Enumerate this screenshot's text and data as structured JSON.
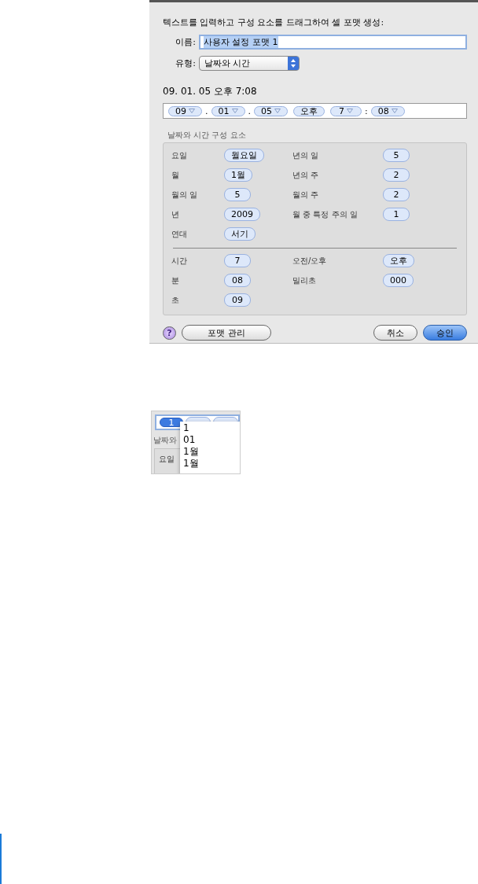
{
  "dialog": {
    "instruction": "텍스트를 입력하고 구성 요소를 드래그하여 셀 포맷 생성:",
    "name_field": {
      "label": "이름:",
      "value": "사용자 설정 포맷 1",
      "selected": true
    },
    "type_popup": {
      "label": "유형:",
      "value": "날짜와 시간"
    },
    "preview": "09. 01. 05 오후 7:08",
    "format_tokens": [
      {
        "kind": "menu",
        "text": "09",
        "after": "."
      },
      {
        "kind": "menu",
        "text": "01",
        "after": "."
      },
      {
        "kind": "menu",
        "text": "05"
      },
      {
        "kind": "plain",
        "text": "오후"
      },
      {
        "kind": "menu",
        "text": "7",
        "after": ":"
      },
      {
        "kind": "menu",
        "text": "08"
      }
    ],
    "components": {
      "title": "날짜와 시간 구성 요소",
      "sections": [
        [
          {
            "label": "요일",
            "value": "월요일"
          },
          {
            "label": "년의 일",
            "value": "5"
          },
          {
            "label": "월",
            "value": "1월"
          },
          {
            "label": "년의 주",
            "value": "2"
          },
          {
            "label": "월의 일",
            "value": "5"
          },
          {
            "label": "월의 주",
            "value": "2"
          },
          {
            "label": "년",
            "value": "2009"
          },
          {
            "label": "월 중 특정 주의 일",
            "value": "1"
          },
          {
            "label": "연대",
            "value": "서기"
          }
        ],
        [
          {
            "label": "시간",
            "value": "7"
          },
          {
            "label": "오전/오후",
            "value": "오후"
          },
          {
            "label": "분",
            "value": "08"
          },
          {
            "label": "밀리초",
            "value": "000"
          },
          {
            "label": "초",
            "value": "09"
          }
        ]
      ]
    },
    "buttons": [
      {
        "kind": "help",
        "text": "?"
      },
      {
        "kind": "normal",
        "text": "포맷 관리"
      },
      {
        "kind": "normal",
        "text": "취소"
      },
      {
        "kind": "default",
        "text": "승인"
      }
    ]
  },
  "inset": {
    "token": {
      "text": "1",
      "selected": true
    },
    "group_label": "날짜와",
    "row_label": "요일",
    "menu_items": [
      "1",
      "01",
      "1월",
      "1월"
    ]
  }
}
